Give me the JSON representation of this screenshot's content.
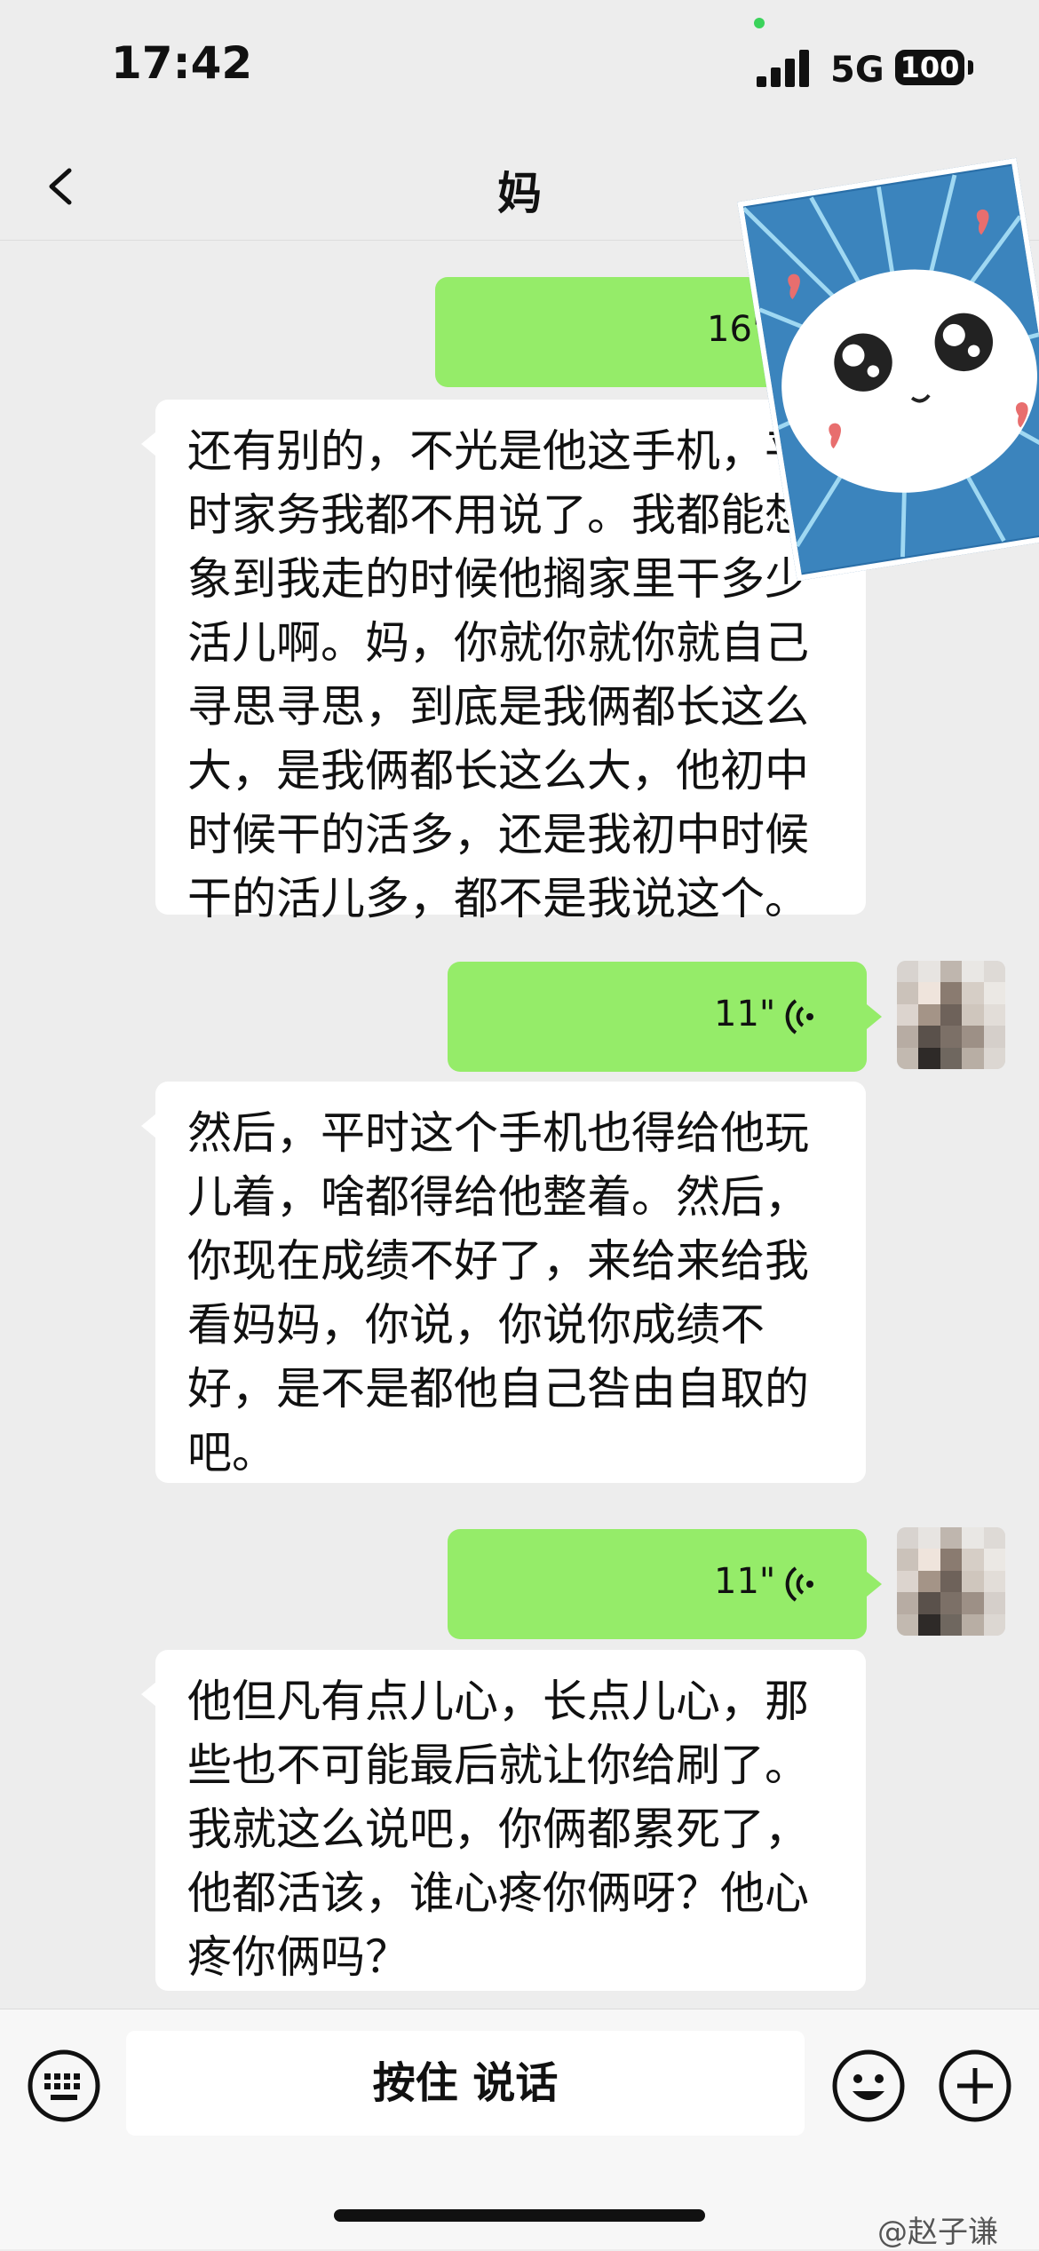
{
  "status_bar": {
    "time": "17:42",
    "network": "5G",
    "battery": "100"
  },
  "header": {
    "title": "妈",
    "more": "···"
  },
  "messages": [
    {
      "side": "outgoing",
      "type": "voice",
      "duration": "16\""
    },
    {
      "side": "incoming",
      "type": "text",
      "text": "还有别的，不光是他这手机，平时家务我都不用说了。我都能想象到我走的时候他搁家里干多少活儿啊。妈，你就你就你就自己寻思寻思，到底是我俩都长这么大，是我俩都长这么大，他初中时候干的活多，还是我初中时候干的活儿多，都不是我说这个。"
    },
    {
      "side": "outgoing",
      "type": "voice",
      "duration": "11\""
    },
    {
      "side": "incoming",
      "type": "text",
      "text": "然后，平时这个手机也得给他玩儿着，啥都得给他整着。然后，你现在成绩不好了，来给来给我看妈妈，你说，你说你成绩不好，是不是都他自己咎由自取的吧。"
    },
    {
      "side": "outgoing",
      "type": "voice",
      "duration": "11\""
    },
    {
      "side": "incoming",
      "type": "text",
      "text": "他但凡有点儿心，长点儿心，那些也不可能最后就让你给刷了。我就这么说吧，你俩都累死了，他都活该，谁心疼你俩呀？他心疼你俩吗？"
    }
  ],
  "input_bar": {
    "hold_to_talk": "按住 说话"
  },
  "watermark": "@赵子谦",
  "colors": {
    "outgoing_bubble": "#95ec69",
    "incoming_bubble": "#ffffff",
    "background": "#ededed"
  }
}
